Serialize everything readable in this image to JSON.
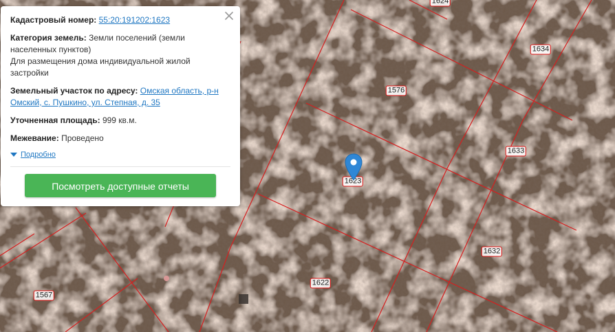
{
  "map": {
    "parcel_labels": [
      "1624",
      "1634",
      "1576",
      "1633",
      "1623",
      "1632",
      "1622",
      "1567"
    ],
    "boundary_color": "#d61f1f",
    "marker_color": "#2f87d6"
  },
  "popup": {
    "cadastral_label": "Кадастровый номер:",
    "cadastral_value": "55:20:191202:1623",
    "category_label": "Категория земель:",
    "category_value": "Земли поселений (земли населенных пунктов)",
    "usage_value": "Для размещения дома индивидуальной жилой застройки",
    "address_label": "Земельный участок по адресу:",
    "address_value": "Омская область, р-н Омский, с. Пушкино, ул. Степная, д. 35",
    "area_label": "Уточненная площадь:",
    "area_value": "999 кв.м.",
    "survey_label": "Межевание:",
    "survey_value": "Проведено",
    "details_label": "Подробно",
    "reports_button": "Посмотреть доступные отчеты",
    "close_icon": "close-icon"
  }
}
